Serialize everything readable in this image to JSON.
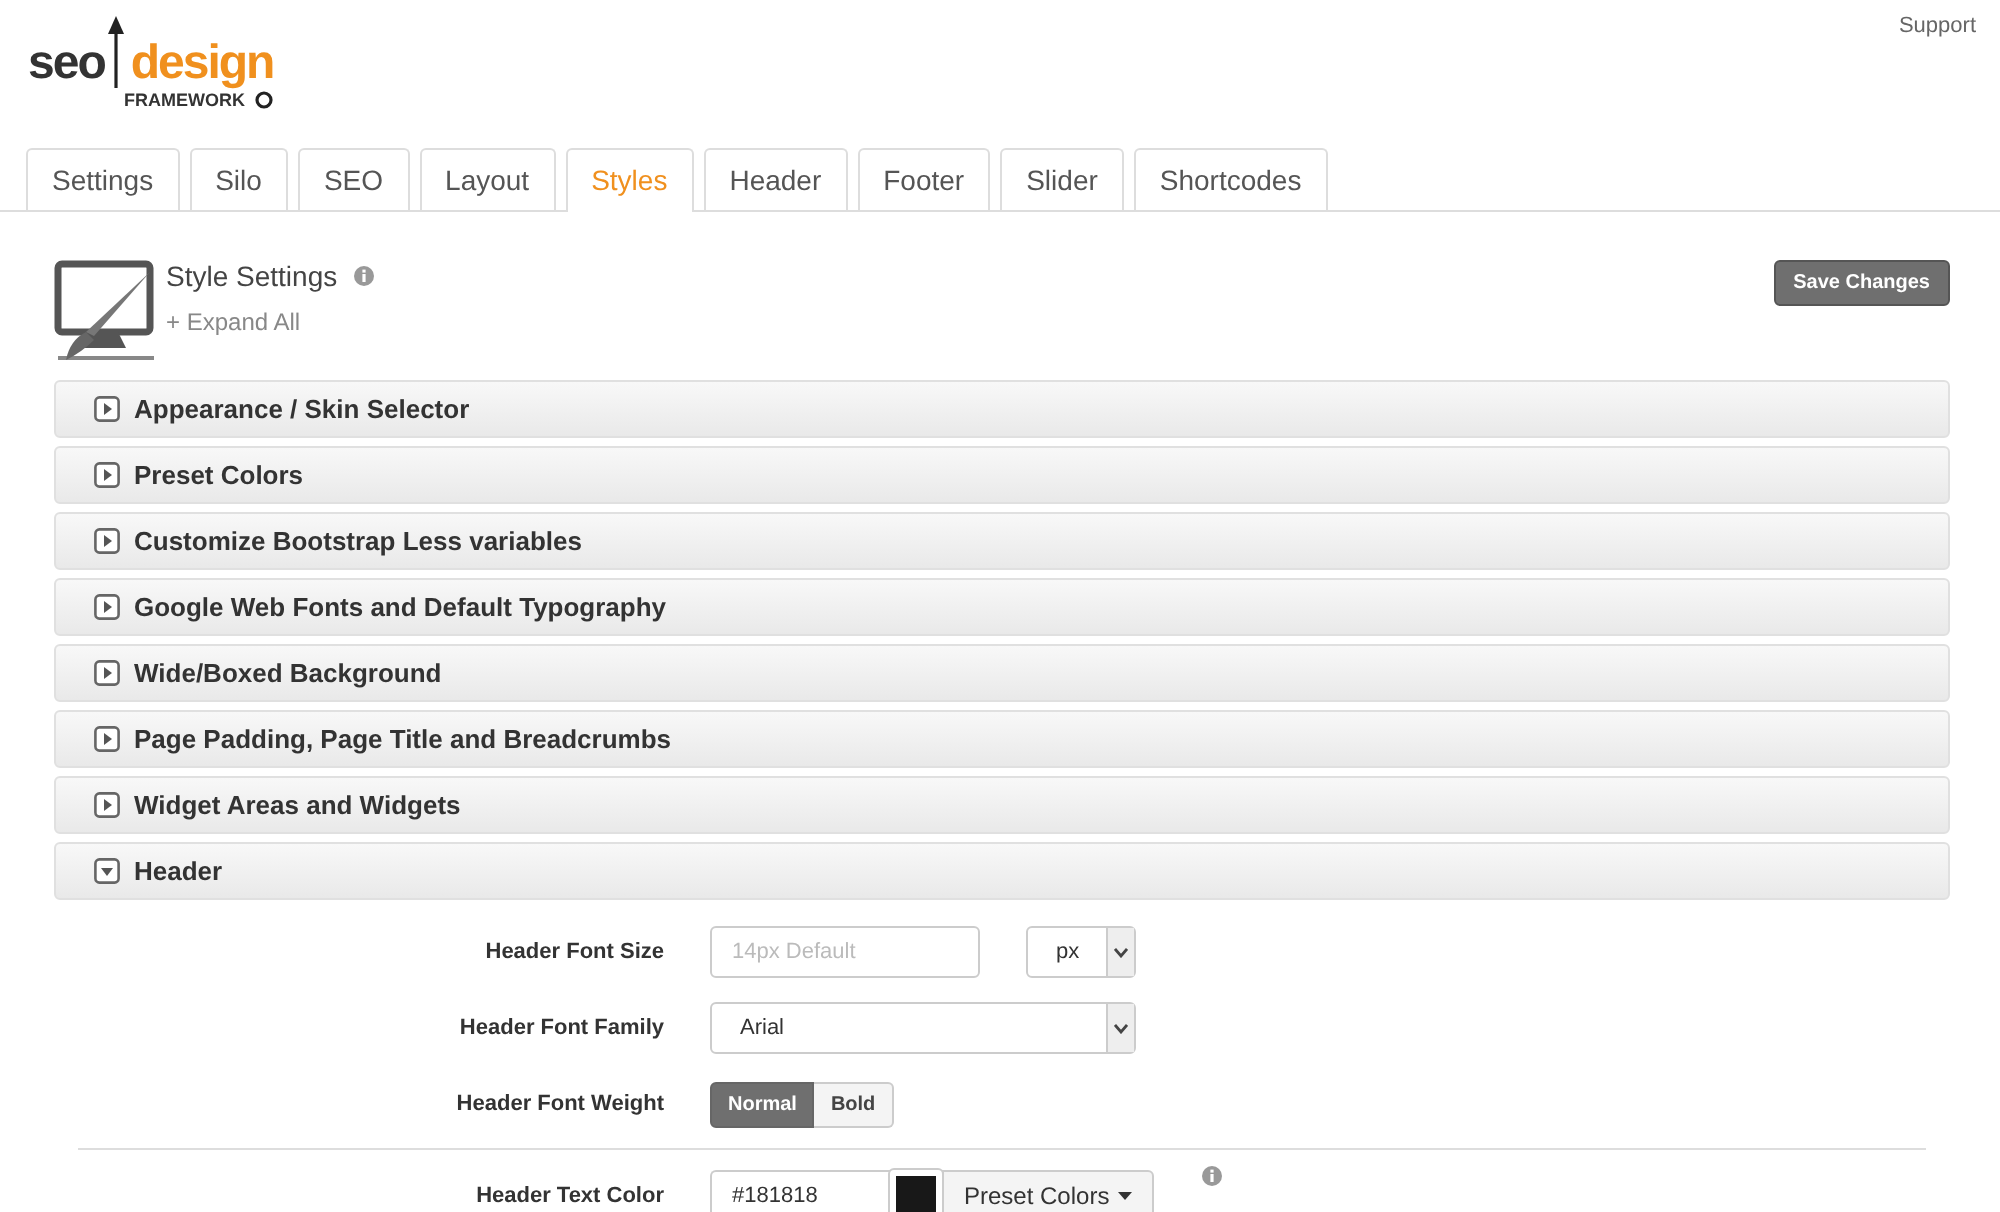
{
  "top_link": "Support",
  "logo": {
    "seo": "seo",
    "design": "design",
    "framework": "FRAMEWORK"
  },
  "tabs": [
    {
      "label": "Settings",
      "selected": false
    },
    {
      "label": "Silo",
      "selected": false
    },
    {
      "label": "SEO",
      "selected": false
    },
    {
      "label": "Layout",
      "selected": false
    },
    {
      "label": "Styles",
      "selected": true
    },
    {
      "label": "Header",
      "selected": false
    },
    {
      "label": "Footer",
      "selected": false
    },
    {
      "label": "Slider",
      "selected": false
    },
    {
      "label": "Shortcodes",
      "selected": false
    }
  ],
  "panel": {
    "title": "Style Settings",
    "expand_all": "+ Expand All",
    "save_button": "Save Changes"
  },
  "sections": [
    {
      "title": "Appearance / Skin Selector",
      "expanded": false
    },
    {
      "title": "Preset Colors",
      "expanded": false
    },
    {
      "title": "Customize Bootstrap Less variables",
      "expanded": false
    },
    {
      "title": "Google Web Fonts and Default Typography",
      "expanded": false
    },
    {
      "title": "Wide/Boxed Background",
      "expanded": false
    },
    {
      "title": "Page Padding, Page Title and Breadcrumbs",
      "expanded": false
    },
    {
      "title": "Widget Areas and Widgets",
      "expanded": false
    },
    {
      "title": "Header",
      "expanded": true,
      "fields": [
        {
          "kind": "size",
          "label": "Header Font Size",
          "placeholder": "14px Default",
          "unit": "px"
        },
        {
          "kind": "select",
          "label": "Header Font Family",
          "value": "Arial"
        },
        {
          "kind": "toggle",
          "label": "Header Font Weight",
          "options": [
            {
              "label": "Normal",
              "selected": true
            },
            {
              "label": "Bold",
              "selected": false
            }
          ]
        },
        {
          "kind": "color",
          "label": "Header Text Color",
          "value": "#181818",
          "button": "Preset Colors"
        }
      ]
    }
  ]
}
